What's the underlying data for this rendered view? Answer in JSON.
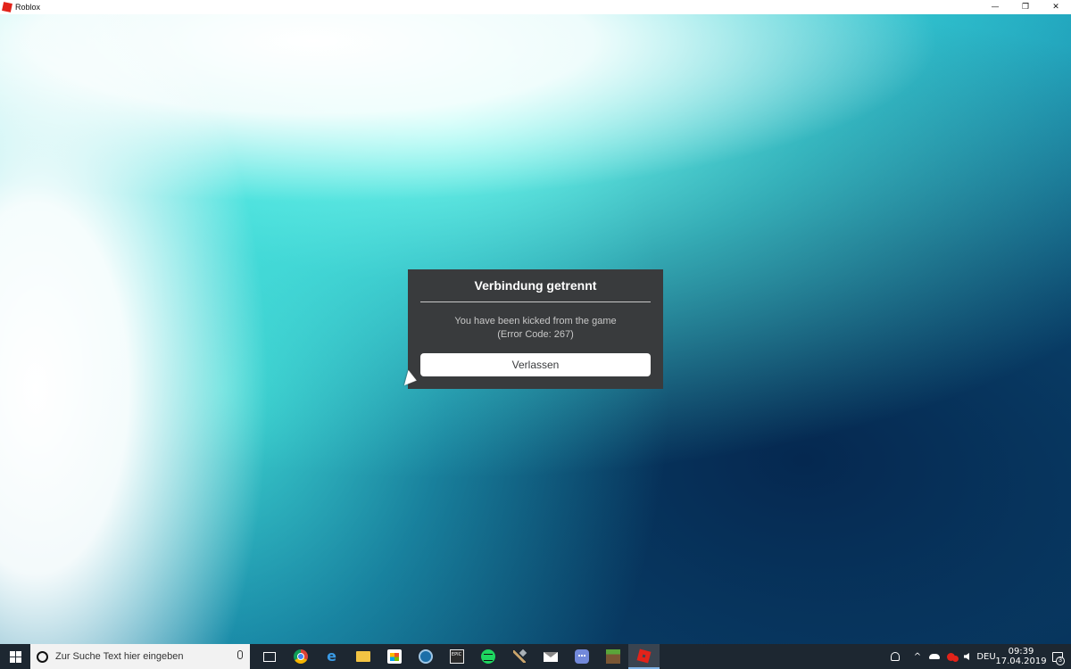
{
  "window": {
    "title": "Roblox",
    "minimize_glyph": "—",
    "restore_glyph": "❐",
    "close_glyph": "✕"
  },
  "dialog": {
    "title": "Verbindung getrennt",
    "message_line1": "You have been kicked from the game",
    "message_line2": "(Error Code: 267)",
    "button_label": "Verlassen"
  },
  "taskbar": {
    "search_placeholder": "Zur Suche Text hier eingeben",
    "pinned_apps": [
      "task-view",
      "chrome",
      "edge",
      "file-explorer",
      "microsoft-store",
      "steam",
      "epic-games",
      "spotify",
      "shovel",
      "mail",
      "discord",
      "minecraft",
      "roblox"
    ],
    "epic_label": "EPIC",
    "tray": {
      "chevron": "^",
      "language": "DEU",
      "time": "09:39",
      "date": "17.04.2019",
      "notification_count": "3"
    }
  },
  "colors": {
    "dialog_bg": "#393b3d",
    "taskbar_bg": "#1d2731",
    "roblox_red": "#e2231a"
  }
}
